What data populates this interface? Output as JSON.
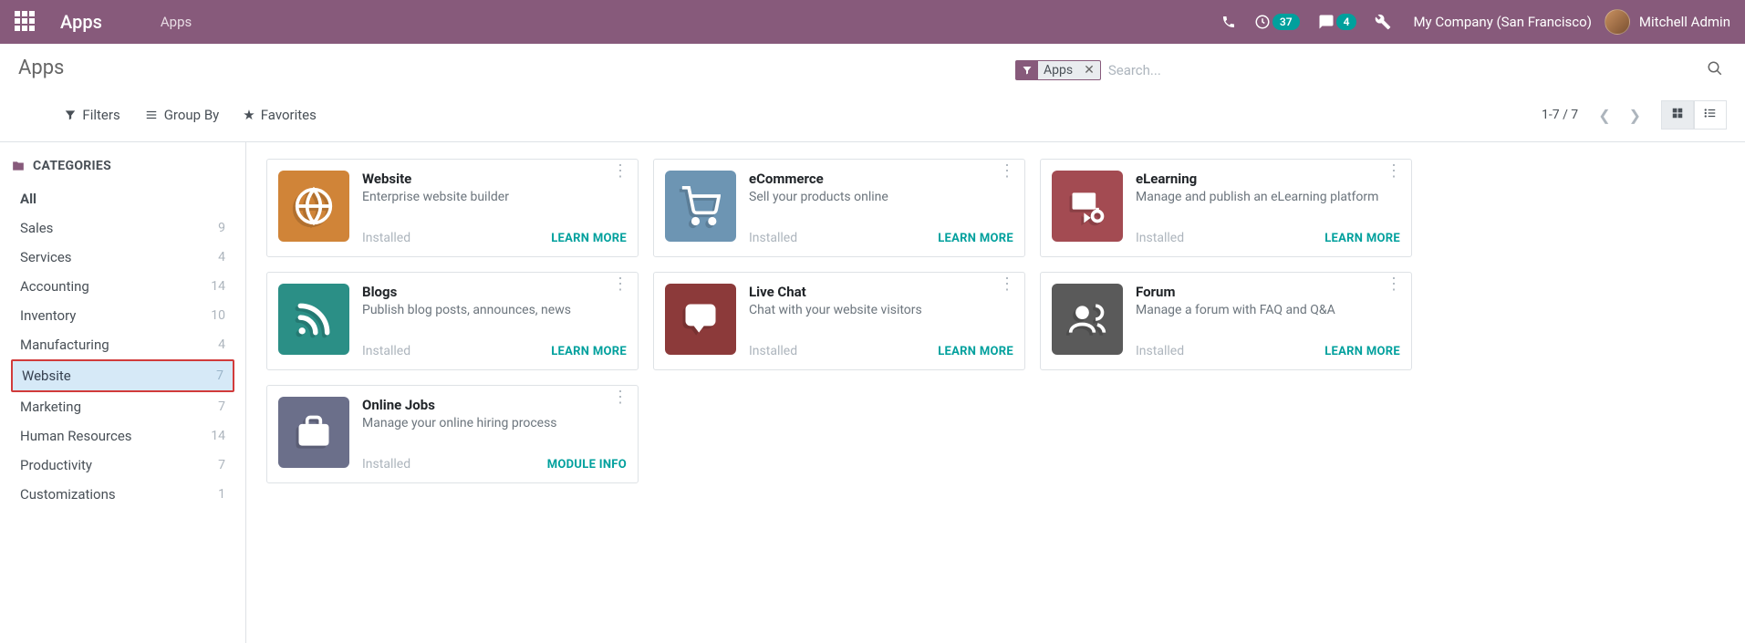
{
  "topbar": {
    "brand": "Apps",
    "crumb": "Apps",
    "activity_count": "37",
    "discuss_count": "4",
    "company": "My Company (San Francisco)",
    "user": "Mitchell Admin"
  },
  "header": {
    "title": "Apps",
    "filter_tag": "Apps",
    "search_placeholder": "Search...",
    "filters_label": "Filters",
    "groupby_label": "Group By",
    "favorites_label": "Favorites",
    "pager": "1-7 / 7"
  },
  "sidebar": {
    "heading": "CATEGORIES",
    "items": [
      {
        "label": "All",
        "count": "",
        "bold": true
      },
      {
        "label": "Sales",
        "count": "9"
      },
      {
        "label": "Services",
        "count": "4"
      },
      {
        "label": "Accounting",
        "count": "14"
      },
      {
        "label": "Inventory",
        "count": "10"
      },
      {
        "label": "Manufacturing",
        "count": "4"
      },
      {
        "label": "Website",
        "count": "7",
        "active": true
      },
      {
        "label": "Marketing",
        "count": "7"
      },
      {
        "label": "Human Resources",
        "count": "14"
      },
      {
        "label": "Productivity",
        "count": "7"
      },
      {
        "label": "Customizations",
        "count": "1"
      }
    ]
  },
  "cards": [
    {
      "title": "Website",
      "desc": "Enterprise website builder",
      "status": "Installed",
      "link": "LEARN MORE",
      "icon": "website"
    },
    {
      "title": "eCommerce",
      "desc": "Sell your products online",
      "status": "Installed",
      "link": "LEARN MORE",
      "icon": "ecommerce"
    },
    {
      "title": "eLearning",
      "desc": "Manage and publish an eLearning platform",
      "status": "Installed",
      "link": "LEARN MORE",
      "icon": "elearning"
    },
    {
      "title": "Blogs",
      "desc": "Publish blog posts, announces, news",
      "status": "Installed",
      "link": "LEARN MORE",
      "icon": "blogs"
    },
    {
      "title": "Live Chat",
      "desc": "Chat with your website visitors",
      "status": "Installed",
      "link": "LEARN MORE",
      "icon": "livechat"
    },
    {
      "title": "Forum",
      "desc": "Manage a forum with FAQ and Q&A",
      "status": "Installed",
      "link": "LEARN MORE",
      "icon": "forum"
    },
    {
      "title": "Online Jobs",
      "desc": "Manage your online hiring process",
      "status": "Installed",
      "link": "MODULE INFO",
      "icon": "jobs"
    }
  ]
}
